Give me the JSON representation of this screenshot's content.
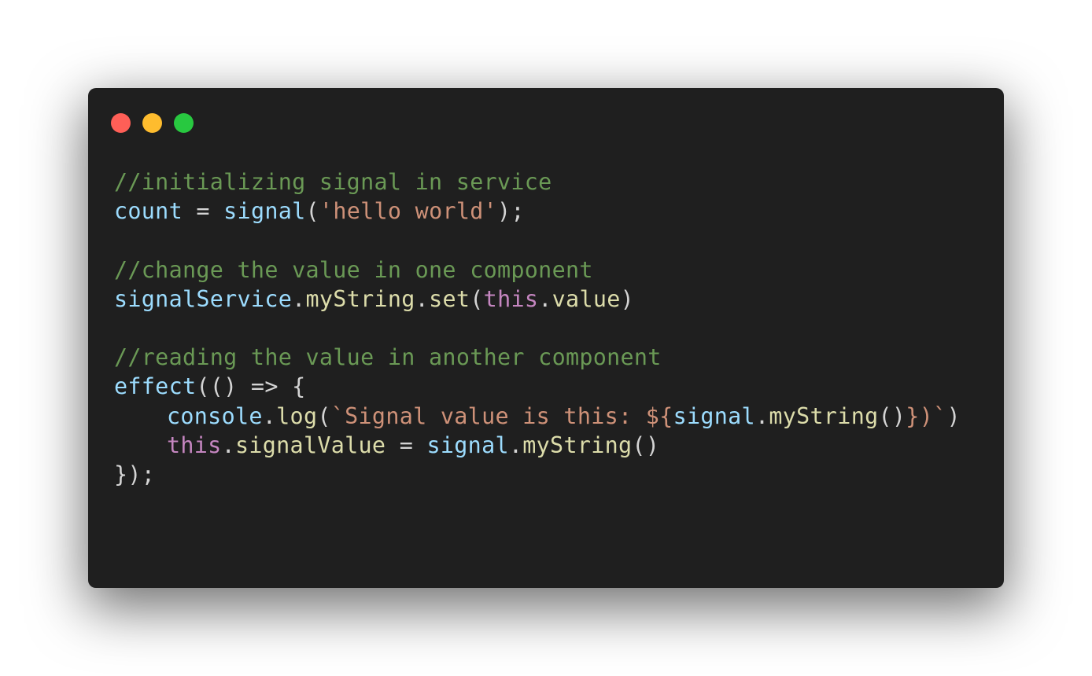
{
  "window": {
    "controls": [
      {
        "name": "close",
        "color": "#ff5f57"
      },
      {
        "name": "minimize",
        "color": "#febc2e"
      },
      {
        "name": "zoom",
        "color": "#28c840"
      }
    ]
  },
  "colors": {
    "background": "#1f1f1f",
    "comment": "#6a9955",
    "variable": "#9cdcfe",
    "function": "#dcdcaa",
    "string": "#ce9178",
    "keyword": "#c586c0",
    "punctuation": "#d4d4d4"
  },
  "code_lines": [
    {
      "indent": 0,
      "tokens": [
        {
          "t": "//initializing signal in service",
          "k": "comment"
        }
      ]
    },
    {
      "indent": 0,
      "tokens": [
        {
          "t": "count",
          "k": "variable"
        },
        {
          "t": " = ",
          "k": "punctuation"
        },
        {
          "t": "signal",
          "k": "variable"
        },
        {
          "t": "(",
          "k": "punctuation"
        },
        {
          "t": "'hello world'",
          "k": "string"
        },
        {
          "t": ");",
          "k": "punctuation"
        }
      ]
    },
    {
      "indent": 0,
      "tokens": []
    },
    {
      "indent": 0,
      "tokens": [
        {
          "t": "//change the value in one component",
          "k": "comment"
        }
      ]
    },
    {
      "indent": 0,
      "tokens": [
        {
          "t": "signalService",
          "k": "variable"
        },
        {
          "t": ".",
          "k": "punctuation"
        },
        {
          "t": "myString",
          "k": "function"
        },
        {
          "t": ".",
          "k": "punctuation"
        },
        {
          "t": "set",
          "k": "function"
        },
        {
          "t": "(",
          "k": "punctuation"
        },
        {
          "t": "this",
          "k": "keyword"
        },
        {
          "t": ".",
          "k": "punctuation"
        },
        {
          "t": "value",
          "k": "function"
        },
        {
          "t": ")",
          "k": "punctuation"
        }
      ]
    },
    {
      "indent": 0,
      "tokens": []
    },
    {
      "indent": 0,
      "tokens": [
        {
          "t": "//reading the value in another component",
          "k": "comment"
        }
      ]
    },
    {
      "indent": 0,
      "tokens": [
        {
          "t": "effect",
          "k": "variable"
        },
        {
          "t": "(() => {",
          "k": "punctuation"
        }
      ]
    },
    {
      "indent": 1,
      "tokens": [
        {
          "t": "console",
          "k": "variable"
        },
        {
          "t": ".",
          "k": "punctuation"
        },
        {
          "t": "log",
          "k": "function"
        },
        {
          "t": "(",
          "k": "punctuation"
        },
        {
          "t": "`Signal value is this: ${",
          "k": "string"
        },
        {
          "t": "signal",
          "k": "variable"
        },
        {
          "t": ".",
          "k": "punctuation"
        },
        {
          "t": "myString",
          "k": "function"
        },
        {
          "t": "()",
          "k": "punctuation"
        },
        {
          "t": "})`",
          "k": "string"
        },
        {
          "t": ")",
          "k": "punctuation"
        }
      ]
    },
    {
      "indent": 1,
      "tokens": [
        {
          "t": "this",
          "k": "keyword"
        },
        {
          "t": ".",
          "k": "punctuation"
        },
        {
          "t": "signalValue",
          "k": "function"
        },
        {
          "t": " = ",
          "k": "punctuation"
        },
        {
          "t": "signal",
          "k": "variable"
        },
        {
          "t": ".",
          "k": "punctuation"
        },
        {
          "t": "myString",
          "k": "function"
        },
        {
          "t": "()",
          "k": "punctuation"
        }
      ]
    },
    {
      "indent": 0,
      "tokens": [
        {
          "t": "});",
          "k": "punctuation"
        }
      ]
    }
  ]
}
